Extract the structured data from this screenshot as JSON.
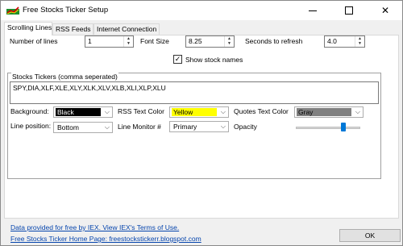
{
  "window": {
    "title": "Free Stocks Ticker Setup",
    "controls": {
      "minimize": "minimize-icon",
      "maximize": "maximize-icon",
      "close": "✕"
    }
  },
  "tabs": [
    {
      "label": "Scrolling Lines",
      "active": true
    },
    {
      "label": "RSS Feeds",
      "active": false
    },
    {
      "label": "Internet Connection",
      "active": false
    }
  ],
  "settings": {
    "lines_label": "Number of lines",
    "lines_value": "1",
    "font_size_label": "Font Size",
    "font_size_value": "8.25",
    "refresh_label": "Seconds to refresh",
    "refresh_value": "4.0",
    "show_names_label": "Show stock names",
    "show_names_checked": true
  },
  "tickers": {
    "group_title": "Stocks Tickers (comma seperated)",
    "value": "SPY,DIA,XLF,XLE,XLY,XLK,XLV,XLB,XLI,XLP,XLU"
  },
  "appearance": {
    "background_label": "Background:",
    "background_value": "Black",
    "background_color": "#000000",
    "background_text_color": "#ffffff",
    "rss_color_label": "RSS Text Color",
    "rss_color_value": "Yellow",
    "rss_color": "#ffff00",
    "quotes_color_label": "Quotes Text Color",
    "quotes_color_value": "Gray",
    "quotes_color": "#808080",
    "line_position_label": "Line position:",
    "line_position_value": "Bottom",
    "line_monitor_label": "Line Monitor #",
    "line_monitor_value": "Primary",
    "opacity_label": "Opacity",
    "opacity_level": 0.74
  },
  "footer": {
    "iex_link": "Data provided for free by IEX. View IEX's Terms of Use.",
    "home_link": "Free Stocks Ticker Home Page: freestockstickerr.blogspot.com",
    "ok_label": "OK"
  }
}
